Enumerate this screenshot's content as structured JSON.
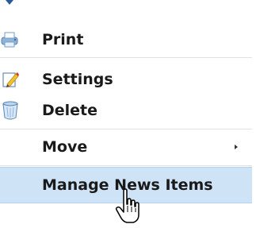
{
  "menu": {
    "items": [
      {
        "label": "Print",
        "icon": "printer-icon"
      },
      {
        "label": "Settings",
        "icon": "settings-pencil-icon"
      },
      {
        "label": "Delete",
        "icon": "trash-icon"
      },
      {
        "label": "Move",
        "icon": "",
        "has_submenu": true
      },
      {
        "label": "Manage News Items",
        "icon": "",
        "highlighted": true
      }
    ]
  },
  "colors": {
    "highlight": "#cfe3f7",
    "highlight_border": "#b4d1ee",
    "text": "#1a1a1a",
    "accent": "#2a5a9a"
  },
  "cursor": "hand-pointer-icon"
}
